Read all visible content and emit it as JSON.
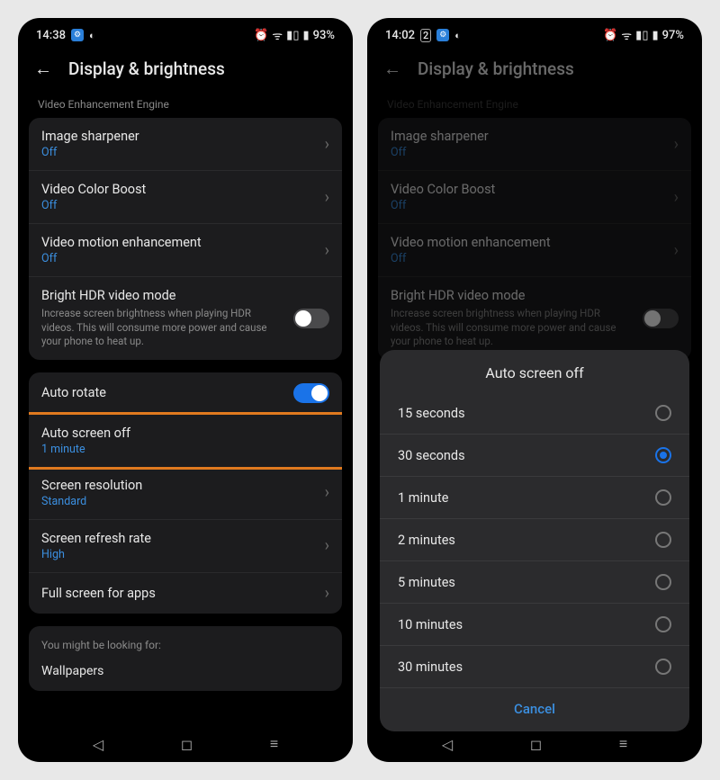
{
  "left": {
    "status": {
      "time": "14:38",
      "battery": "93%"
    },
    "header": {
      "title": "Display & brightness"
    },
    "section_label": "Video Enhancement Engine",
    "rows": {
      "image_sharpener": {
        "title": "Image sharpener",
        "sub": "Off"
      },
      "video_color_boost": {
        "title": "Video Color Boost",
        "sub": "Off"
      },
      "video_motion": {
        "title": "Video motion enhancement",
        "sub": "Off"
      },
      "bright_hdr": {
        "title": "Bright HDR video mode",
        "desc": "Increase screen brightness when playing HDR videos. This will consume more power and cause your phone to heat up."
      },
      "auto_rotate": {
        "title": "Auto rotate"
      },
      "auto_screen_off": {
        "title": "Auto screen off",
        "sub": "1 minute"
      },
      "screen_resolution": {
        "title": "Screen resolution",
        "sub": "Standard"
      },
      "refresh_rate": {
        "title": "Screen refresh rate",
        "sub": "High"
      },
      "full_screen": {
        "title": "Full screen for apps"
      }
    },
    "suggest": {
      "label": "You might be looking for:",
      "item": "Wallpapers"
    }
  },
  "right": {
    "status": {
      "time": "14:02",
      "battery": "97%"
    },
    "header": {
      "title": "Display & brightness"
    },
    "section_label": "Video Enhancement Engine",
    "rows": {
      "image_sharpener": {
        "title": "Image sharpener",
        "sub": "Off"
      },
      "video_color_boost": {
        "title": "Video Color Boost",
        "sub": "Off"
      },
      "video_motion": {
        "title": "Video motion enhancement",
        "sub": "Off"
      },
      "bright_hdr": {
        "title": "Bright HDR video mode",
        "desc": "Increase screen brightness when playing HDR videos. This will consume more power and cause your phone to heat up."
      }
    },
    "dialog": {
      "title": "Auto screen off",
      "options": {
        "0": "15 seconds",
        "1": "30 seconds",
        "2": "1 minute",
        "3": "2 minutes",
        "4": "5 minutes",
        "5": "10 minutes",
        "6": "30 minutes"
      },
      "selected_index": 1,
      "cancel": "Cancel"
    }
  }
}
